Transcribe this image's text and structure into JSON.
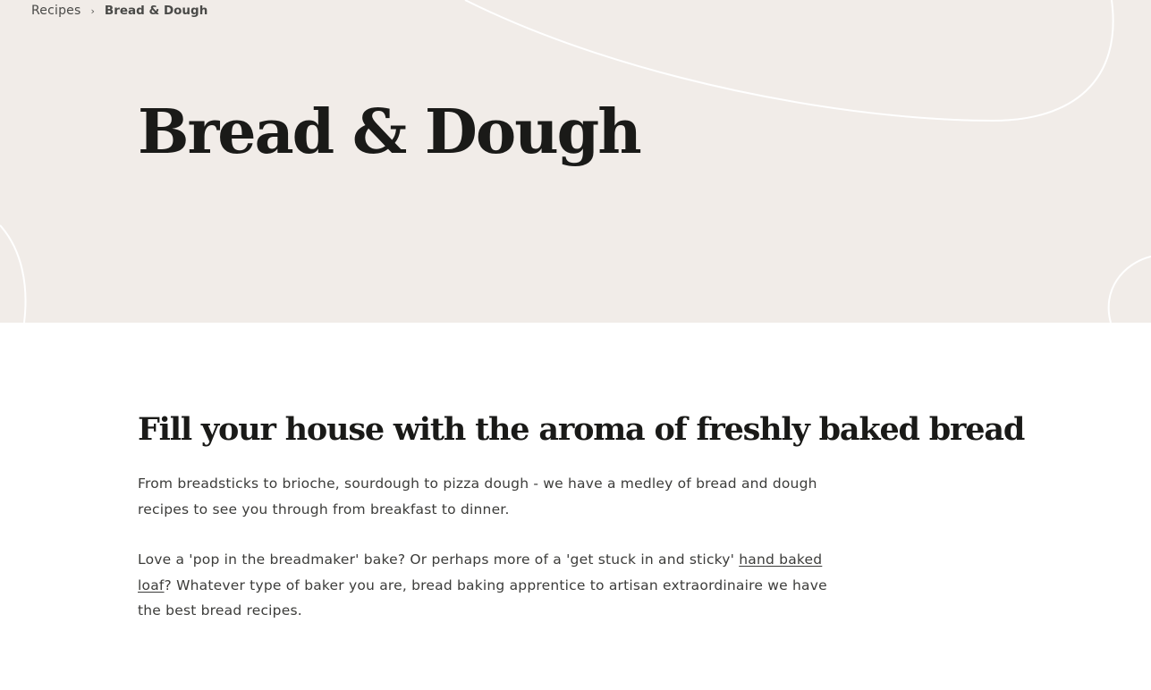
{
  "breadcrumb": {
    "root": "Recipes",
    "separator": "›",
    "current": "Bread & Dough"
  },
  "hero": {
    "title": "Bread & Dough",
    "background_color": "#f1ece8"
  },
  "intro": {
    "heading": "Fill your house with the aroma of freshly baked bread",
    "paragraph1": "From breadsticks to brioche, sourdough to pizza dough - we have a medley of bread and dough recipes to see you through from breakfast to dinner.",
    "paragraph2_before": "Love a 'pop in the breadmaker' bake? Or perhaps more of a 'get stuck in and sticky' ",
    "paragraph2_link": "hand baked loaf",
    "paragraph2_after": "? Whatever type of baker you are, bread baking apprentice to artisan extraordinaire we have the best bread recipes."
  }
}
